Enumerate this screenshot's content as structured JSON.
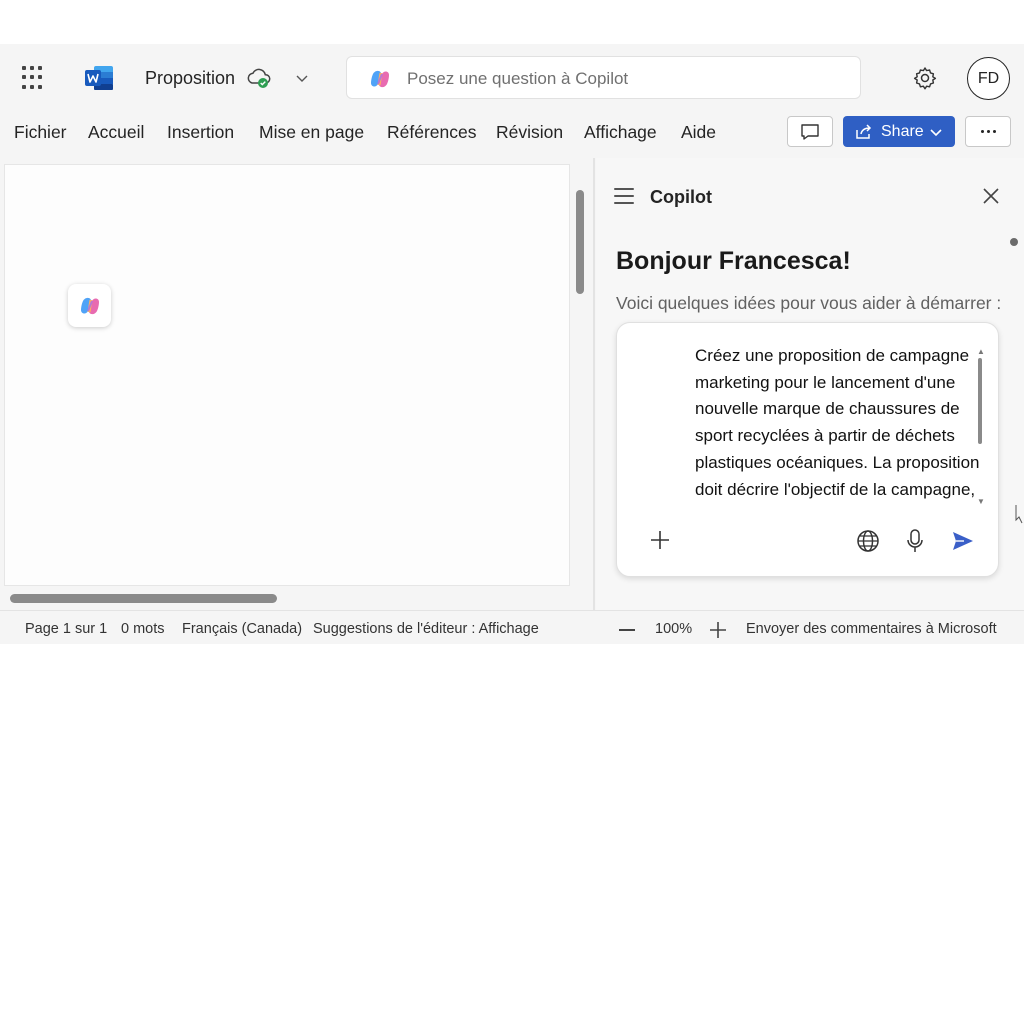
{
  "titlebar": {
    "doc_title": "Proposition",
    "search_placeholder": "Posez une question à Copilot",
    "avatar_initials": "FD"
  },
  "icons": {
    "app_launcher": "grid-icon",
    "app_logo": "word-logo-icon",
    "sync_status": "cloud-check-icon",
    "settings": "gear-icon",
    "comments": "comment-icon",
    "share": "share-icon",
    "more": "more-options-icon"
  },
  "menu": {
    "items": [
      "Fichier",
      "Accueil",
      "Insertion",
      "Mise en page",
      "Références",
      "Révision",
      "Affichage",
      "Aide"
    ],
    "share_label": "Share"
  },
  "copilot": {
    "title": "Copilot",
    "greeting": "Bonjour Francesca!",
    "subtitle": "Voici quelques idées pour vous aider à démarrer :",
    "prompt_text": "Créez une proposition de campagne marketing pour le lancement d'une nouvelle marque de chaussures de sport recyclées à partir de déchets plastiques océaniques. La proposition doit décrire l'objectif de la campagne, le public cible"
  },
  "status": {
    "page": "Page 1 sur 1",
    "words": "0 mots",
    "language": "Français (Canada)",
    "editor": "Suggestions de l'éditeur : Affichage",
    "zoom": "100%",
    "feedback": "Envoyer des commentaires à Microsoft"
  },
  "colors": {
    "accent": "#2f5fc4",
    "word_blue": "#185abd",
    "sync_green": "#2e9e52"
  }
}
